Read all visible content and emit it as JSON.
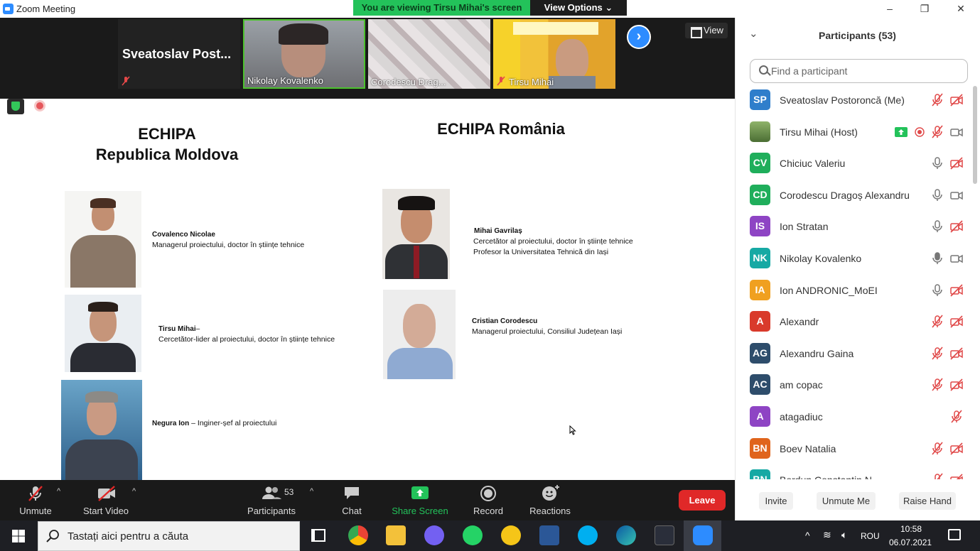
{
  "window": {
    "app_title": "Zoom Meeting",
    "viewing_banner": "You are viewing Tirsu Mihai's screen",
    "view_options": "View Options"
  },
  "strip": {
    "tiles": [
      {
        "name": "Sveatoslav  Post...",
        "label": ""
      },
      {
        "name": "Nikolay Kovalenko"
      },
      {
        "name": "Corodescu Drag..."
      },
      {
        "name": "Tirsu Mihai"
      }
    ],
    "view_label": "View"
  },
  "slide": {
    "left_title_1": "ECHIPA",
    "left_title_2": "Republica Moldova",
    "right_title": "ECHIPA România",
    "people": [
      {
        "name": "Covalenco Nicolae",
        "line1": "Managerul proiectului, doctor în științe tehnice",
        "line2": ""
      },
      {
        "name": "Tirsu Mihai",
        "suffix": "–",
        "line1": "Cercetător-lider al proiectului, doctor în științe tehnice"
      },
      {
        "name": "Negura Ion",
        "inline": " – Inginer-șef al proiectului"
      },
      {
        "name": "Mihai Gavrilaș",
        "line1": "Cercetător al proiectului, doctor în științe tehnice",
        "line2": "Profesor la Universitatea Tehnică din Iași"
      },
      {
        "name": "Cristian Corodescu",
        "line1": "Managerul proiectului, Consiliul Județean Iași"
      }
    ]
  },
  "toolbar": {
    "unmute": "Unmute",
    "start_video": "Start Video",
    "participants": "Participants",
    "participants_count": "53",
    "chat": "Chat",
    "share_screen": "Share Screen",
    "record": "Record",
    "reactions": "Reactions",
    "leave": "Leave"
  },
  "panel": {
    "title": "Participants (53)",
    "search_placeholder": "Find a participant",
    "participants": [
      {
        "initials": "SP",
        "name": "Sveatoslav Postoroncă (Me)",
        "color": "#2f7ecb",
        "mic": "muted",
        "video": "off"
      },
      {
        "initials": "",
        "name": "Tirsu Mihai (Host)",
        "color": "#5a8a3a",
        "mic": "muted",
        "video": "on",
        "sharing": true,
        "recording": true
      },
      {
        "initials": "CV",
        "name": "Chiciuc Valeriu",
        "color": "#1fae5b",
        "mic": "on",
        "video": "off"
      },
      {
        "initials": "CD",
        "name": "Corodescu Dragoș Alexandru",
        "color": "#1fae5b",
        "mic": "on",
        "video": "on"
      },
      {
        "initials": "IS",
        "name": "Ion Stratan",
        "color": "#8e44c4",
        "mic": "on",
        "video": "off"
      },
      {
        "initials": "NK",
        "name": "Nikolay Kovalenko",
        "color": "#16a9a4",
        "mic": "active",
        "video": "on"
      },
      {
        "initials": "IA",
        "name": "Ion ANDRONIC_MoEI",
        "color": "#f0a020",
        "mic": "on",
        "video": "off"
      },
      {
        "initials": "A",
        "name": "Alexandr",
        "color": "#d93a2b",
        "mic": "muted",
        "video": "off"
      },
      {
        "initials": "AG",
        "name": "Alexandru Gaina",
        "color": "#2e4d6b",
        "mic": "muted",
        "video": "off"
      },
      {
        "initials": "AC",
        "name": "am copac",
        "color": "#2e4d6b",
        "mic": "muted",
        "video": "off"
      },
      {
        "initials": "A",
        "name": "atagadiuc",
        "color": "#8e44c4",
        "mic": "muted",
        "video": "none"
      },
      {
        "initials": "BN",
        "name": "Boev Natalia",
        "color": "#e0641c",
        "mic": "muted",
        "video": "off"
      },
      {
        "initials": "BN",
        "name": "Bordun Constantin N...",
        "color": "#16a9a4",
        "mic": "muted",
        "video": "off"
      }
    ],
    "invite": "Invite",
    "unmute_me": "Unmute Me",
    "raise_hand": "Raise Hand"
  },
  "taskbar": {
    "search_text": "Tastați aici pentru a căuta",
    "language": "ROU",
    "time": "10:58",
    "date": "06.07.2021"
  },
  "colors": {
    "accent": "#2d8cff",
    "banner": "#23c25a",
    "leave": "#e02828",
    "share": "#23c25a"
  }
}
